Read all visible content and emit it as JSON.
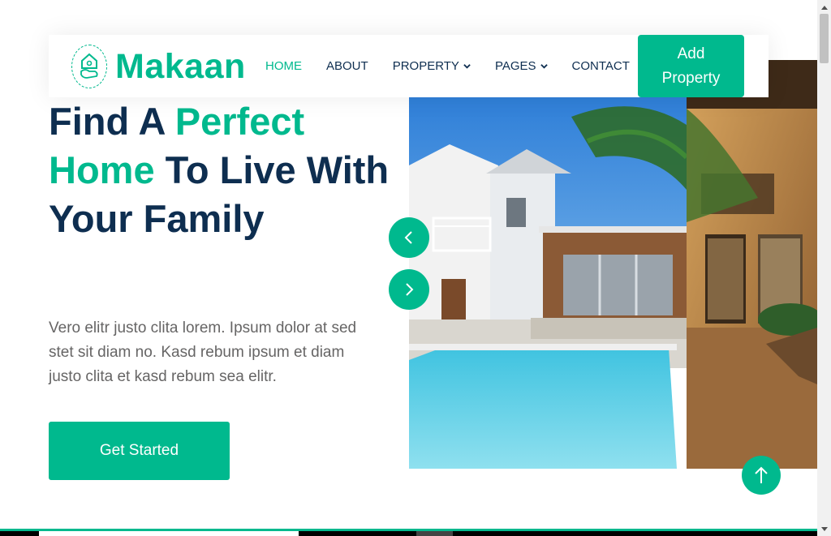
{
  "brand": {
    "name": "Makaan",
    "logo_icon": "house-in-hand-icon"
  },
  "nav": {
    "items": [
      {
        "label": "HOME",
        "active": true,
        "dropdown": false
      },
      {
        "label": "ABOUT",
        "active": false,
        "dropdown": false
      },
      {
        "label": "PROPERTY",
        "active": false,
        "dropdown": true
      },
      {
        "label": "PAGES",
        "active": false,
        "dropdown": true
      },
      {
        "label": "CONTACT",
        "active": false,
        "dropdown": false
      }
    ],
    "add_property_label": "Add Property"
  },
  "hero": {
    "title_part1": "Find A ",
    "title_accent1": "Perfect Home",
    "title_part2": " To Live With Your Family",
    "description": "Vero elitr justo clita lorem. Ipsum dolor at sed stet sit diam no. Kasd rebum ipsum et diam justo clita et kasd rebum sea elitr.",
    "cta_label": "Get Started"
  },
  "carousel": {
    "prev_icon": "chevron-left-icon",
    "next_icon": "chevron-right-icon"
  },
  "back_to_top_icon": "arrow-up-icon",
  "colors": {
    "primary": "#00B98E",
    "dark": "#0E2E50",
    "text": "#666565"
  }
}
